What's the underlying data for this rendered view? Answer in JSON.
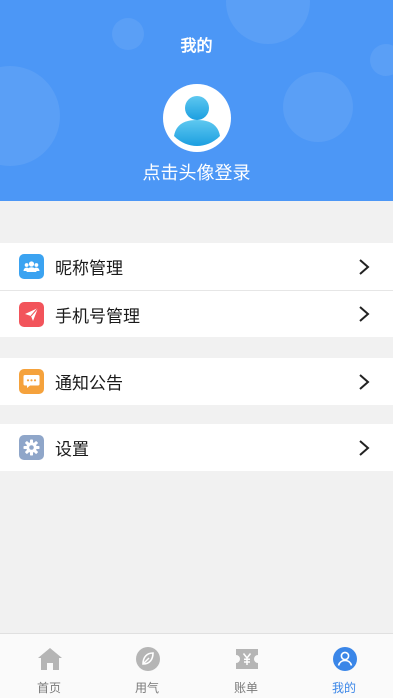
{
  "header": {
    "title": "我的",
    "login_prompt": "点击头像登录"
  },
  "colors": {
    "header_bg": "#4c97f6",
    "nickname_icon": "#3ba3f1",
    "phone_icon": "#f2545b",
    "notice_icon": "#f5a23c",
    "settings_icon": "#8fa6c9",
    "tab_active": "#3a86e8",
    "tab_inactive": "#b5b5b5"
  },
  "menu": {
    "nickname": {
      "label": "昵称管理",
      "icon": "users-icon"
    },
    "phone": {
      "label": "手机号管理",
      "icon": "paper-plane-icon"
    },
    "notice": {
      "label": "通知公告",
      "icon": "message-icon"
    },
    "settings": {
      "label": "设置",
      "icon": "gear-icon"
    }
  },
  "tabbar": {
    "tabs": [
      {
        "label": "首页",
        "icon": "home-icon",
        "active": false
      },
      {
        "label": "用气",
        "icon": "leaf-icon",
        "active": false
      },
      {
        "label": "账单",
        "icon": "bill-icon",
        "active": false
      },
      {
        "label": "我的",
        "icon": "user-icon",
        "active": true
      }
    ]
  }
}
